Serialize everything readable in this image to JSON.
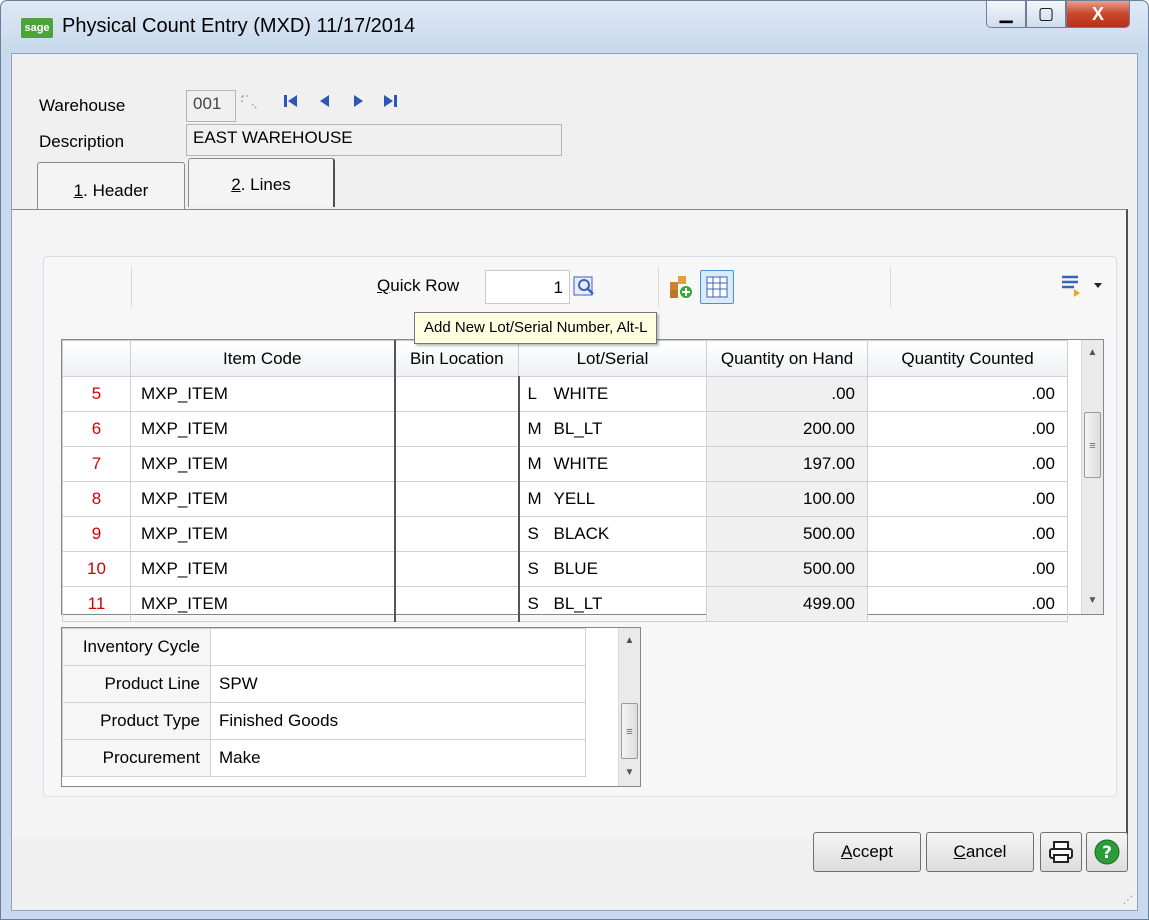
{
  "window": {
    "logo_text": "sage",
    "title": "Physical Count Entry (MXD) 11/17/2014",
    "minimize_glyph": "▁",
    "restore_glyph": "▢",
    "close_glyph": "X"
  },
  "header": {
    "warehouse_label": "Warehouse",
    "warehouse_value": "001",
    "description_label": "Description",
    "description_value": "EAST WAREHOUSE"
  },
  "tabs": [
    {
      "label": "1. Header",
      "hotkey": "1",
      "rest": ". Header"
    },
    {
      "label": "2. Lines",
      "hotkey": "2",
      "rest": ". Lines"
    }
  ],
  "toolbar": {
    "quick_row_label": "Quick Row",
    "quick_row_hotkey": "Q",
    "quick_row_rest": "uick Row",
    "quick_row_value": "1",
    "tooltip": "Add New Lot/Serial Number, Alt-L"
  },
  "grid": {
    "columns": [
      "",
      "Item Code",
      "Bin Location",
      "Lot/Serial",
      "Quantity on Hand",
      "Quantity Counted"
    ],
    "rows": [
      {
        "num": "5",
        "item": "MXP_ITEM",
        "bin": "",
        "lot_prefix": "L",
        "lot": "WHITE",
        "on_hand": ".00",
        "counted": ".00"
      },
      {
        "num": "6",
        "item": "MXP_ITEM",
        "bin": "",
        "lot_prefix": "M",
        "lot": "BL_LT",
        "on_hand": "200.00",
        "counted": ".00"
      },
      {
        "num": "7",
        "item": "MXP_ITEM",
        "bin": "",
        "lot_prefix": "M",
        "lot": "WHITE",
        "on_hand": "197.00",
        "counted": ".00"
      },
      {
        "num": "8",
        "item": "MXP_ITEM",
        "bin": "",
        "lot_prefix": "M",
        "lot": "YELL",
        "on_hand": "100.00",
        "counted": ".00"
      },
      {
        "num": "9",
        "item": "MXP_ITEM",
        "bin": "",
        "lot_prefix": "S",
        "lot": "BLACK",
        "on_hand": "500.00",
        "counted": ".00"
      },
      {
        "num": "10",
        "item": "MXP_ITEM",
        "bin": "",
        "lot_prefix": "S",
        "lot": "BLUE",
        "on_hand": "500.00",
        "counted": ".00"
      },
      {
        "num": "11",
        "item": "MXP_ITEM",
        "bin": "",
        "lot_prefix": "S",
        "lot": "BL_LT",
        "on_hand": "499.00",
        "counted": ".00"
      }
    ]
  },
  "details": [
    {
      "label": "Inventory Cycle",
      "value": ""
    },
    {
      "label": "Product Line",
      "value": "SPW"
    },
    {
      "label": "Product Type",
      "value": "Finished Goods"
    },
    {
      "label": "Procurement",
      "value": "Make"
    }
  ],
  "buttons": {
    "accept": "Accept",
    "accept_hotkey": "A",
    "accept_rest": "ccept",
    "cancel": "Cancel",
    "cancel_hotkey": "C",
    "cancel_rest": "ancel"
  },
  "colors": {
    "row_number": "#d20000",
    "help_button": "#2a9d3a",
    "title_bar": "#c7d8ec"
  }
}
